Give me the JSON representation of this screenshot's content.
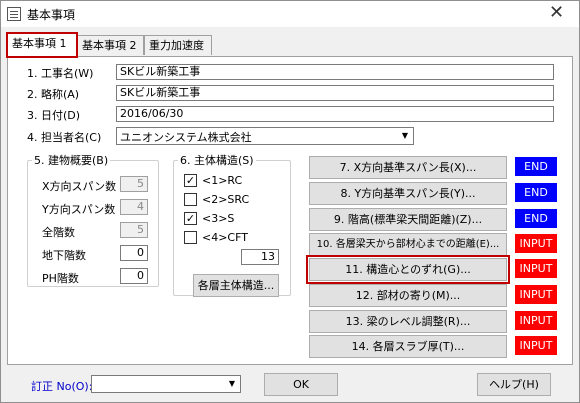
{
  "window": {
    "title": "基本事項",
    "close_glyph": "✕",
    "icon": "document-icon"
  },
  "tabs": [
    {
      "label": "基本事項 1",
      "active": true
    },
    {
      "label": "基本事項 2",
      "active": false
    },
    {
      "label": "重力加速度",
      "active": false
    }
  ],
  "fields": {
    "construction_name_label": "1. 工事名(W)",
    "construction_name_value": "SKビル新築工事",
    "abbreviation_label": "2. 略称(A)",
    "abbreviation_value": "SKビル新築工事",
    "date_label": "3. 日付(D)",
    "date_value": "2016/06/30",
    "person_label": "4. 担当者名(C)",
    "person_value": "ユニオンシステム株式会社"
  },
  "building": {
    "legend": "5. 建物概要(B)",
    "rows": [
      {
        "label": "X方向スパン数",
        "value": "5",
        "editable": false
      },
      {
        "label": "Y方向スパン数",
        "value": "4",
        "editable": false
      },
      {
        "label": "全階数",
        "value": "5",
        "editable": false
      },
      {
        "label": "地下階数",
        "value": "0",
        "editable": true
      },
      {
        "label": "PH階数",
        "value": "0",
        "editable": true
      }
    ]
  },
  "structure": {
    "legend": "6. 主体構造(S)",
    "options": [
      {
        "label": "<1>RC",
        "checked": true,
        "mark": "✓"
      },
      {
        "label": "<2>SRC",
        "checked": false,
        "mark": ""
      },
      {
        "label": "<3>S",
        "checked": true,
        "mark": "✓"
      },
      {
        "label": "<4>CFT",
        "checked": false,
        "mark": ""
      }
    ],
    "cft_value": "13",
    "floor_button": "各層主体構造..."
  },
  "actions": [
    {
      "label": "7. X方向基準スパン長(X)...",
      "status": "END"
    },
    {
      "label": "8. Y方向基準スパン長(Y)...",
      "status": "END"
    },
    {
      "label": "9. 階高(標準梁天間距離)(Z)...",
      "status": "END"
    },
    {
      "label": "10. 各層梁天から部材心までの距離(E)...",
      "status": "INPUT"
    },
    {
      "label": "11. 構造心とのずれ(G)...",
      "status": "INPUT"
    },
    {
      "label": "12. 部材の寄り(M)...",
      "status": "INPUT"
    },
    {
      "label": "13. 梁のレベル調整(R)...",
      "status": "INPUT"
    },
    {
      "label": "14. 各層スラブ厚(T)...",
      "status": "INPUT"
    }
  ],
  "colors": {
    "end": "#0000ff",
    "input": "#ff0000",
    "highlight": "#c00000"
  },
  "footer": {
    "revision_label": "訂正 No(O):",
    "revision_value": "",
    "ok": "OK",
    "help": "ヘルプ(H)",
    "dropdown_glyph": "▼"
  }
}
